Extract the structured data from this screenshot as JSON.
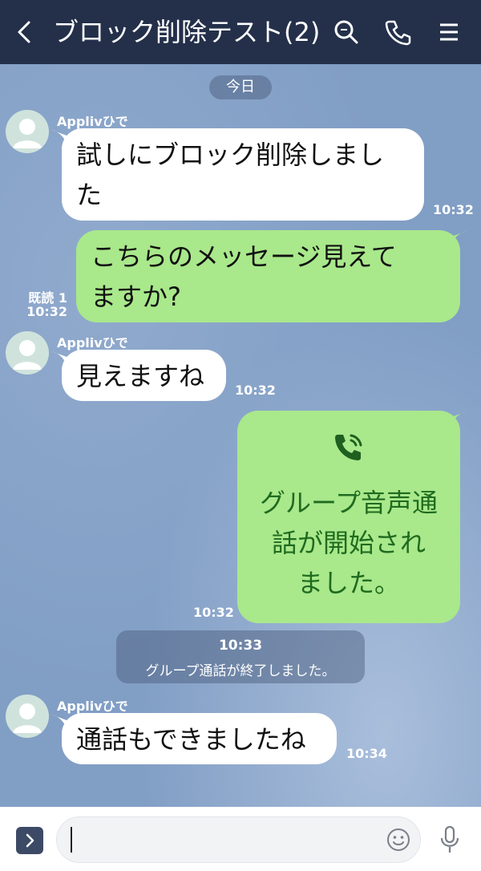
{
  "header": {
    "title": "ブロック削除テスト(2)",
    "icons": [
      "back-icon",
      "search-icon",
      "phone-icon",
      "menu-icon"
    ]
  },
  "chat": {
    "date_label": "今日",
    "messages": [
      {
        "type": "incoming",
        "sender": "Applivひで",
        "lines": [
          "試しにブロック削除しまし",
          "た"
        ],
        "time": "10:32"
      },
      {
        "type": "outgoing",
        "lines": [
          "こちらのメッセージ見えて",
          "ますか?"
        ],
        "read": "既読 1",
        "time": "10:32"
      },
      {
        "type": "incoming",
        "sender": "Applivひで",
        "lines": [
          "見えますね"
        ],
        "time": "10:32"
      },
      {
        "type": "outgoing-call",
        "lines": [
          "グループ音声通",
          "話が開始され",
          "ました。"
        ],
        "time": "10:32",
        "icon": "phone-call-icon"
      },
      {
        "type": "incoming",
        "sender": "Applivひで",
        "lines": [
          "通話もできましたね"
        ],
        "time": "10:34"
      }
    ],
    "system": {
      "time": "10:33",
      "text": "グループ通話が終了しました。"
    }
  },
  "input": {
    "value": "",
    "icons": [
      "expand-icon",
      "emoji-icon",
      "mic-icon"
    ]
  },
  "colors": {
    "header_bg": "#24304a",
    "chat_bg": "#819ec5",
    "outgoing_bubble": "#a9e88b",
    "incoming_bubble": "#ffffff",
    "call_text": "#1f6b1f"
  }
}
